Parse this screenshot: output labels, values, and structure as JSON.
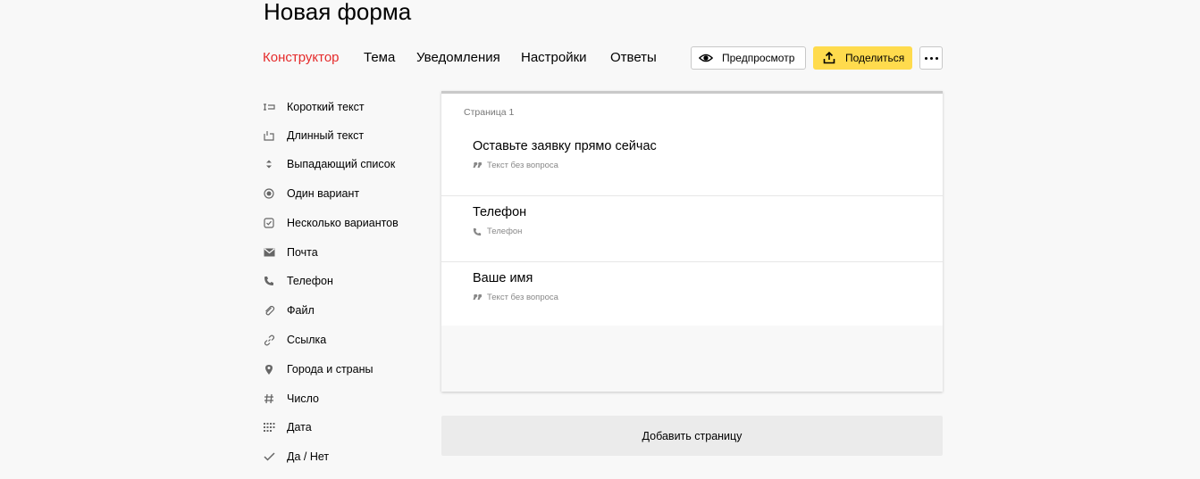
{
  "header": {
    "title": "Новая форма"
  },
  "tabs": [
    {
      "label": "Конструктор",
      "active": true
    },
    {
      "label": "Тема"
    },
    {
      "label": "Уведомления"
    },
    {
      "label": "Настройки"
    },
    {
      "label": "Ответы"
    }
  ],
  "toolbar": {
    "preview_label": "Предпросмотр",
    "share_label": "Поделиться",
    "accent_color": "#ffdb4d"
  },
  "sidebar": {
    "items": [
      {
        "label": "Короткий текст",
        "icon": "short-text-icon"
      },
      {
        "label": "Длинный текст",
        "icon": "long-text-icon"
      },
      {
        "label": "Выпадающий список",
        "icon": "dropdown-icon"
      },
      {
        "label": "Один вариант",
        "icon": "radio-icon"
      },
      {
        "label": "Несколько вариантов",
        "icon": "checkbox-icon"
      },
      {
        "label": "Почта",
        "icon": "mail-icon"
      },
      {
        "label": "Телефон",
        "icon": "phone-icon"
      },
      {
        "label": "Файл",
        "icon": "paperclip-icon"
      },
      {
        "label": "Ссылка",
        "icon": "link-icon"
      },
      {
        "label": "Города и страны",
        "icon": "location-pin-icon"
      },
      {
        "label": "Число",
        "icon": "hash-icon"
      },
      {
        "label": "Дата",
        "icon": "calendar-icon"
      },
      {
        "label": "Да / Нет",
        "icon": "check-icon"
      }
    ]
  },
  "page": {
    "label": "Страница 1",
    "questions": [
      {
        "title": "Оставьте заявку прямо сейчас",
        "type": "Текст без вопроса",
        "icon": "quote-icon"
      },
      {
        "title": "Телефон",
        "type": "Телефон",
        "icon": "phone-icon"
      },
      {
        "title": "Ваше имя",
        "type": "Текст без вопроса",
        "icon": "quote-icon"
      }
    ]
  },
  "add_page_label": "Добавить страницу"
}
